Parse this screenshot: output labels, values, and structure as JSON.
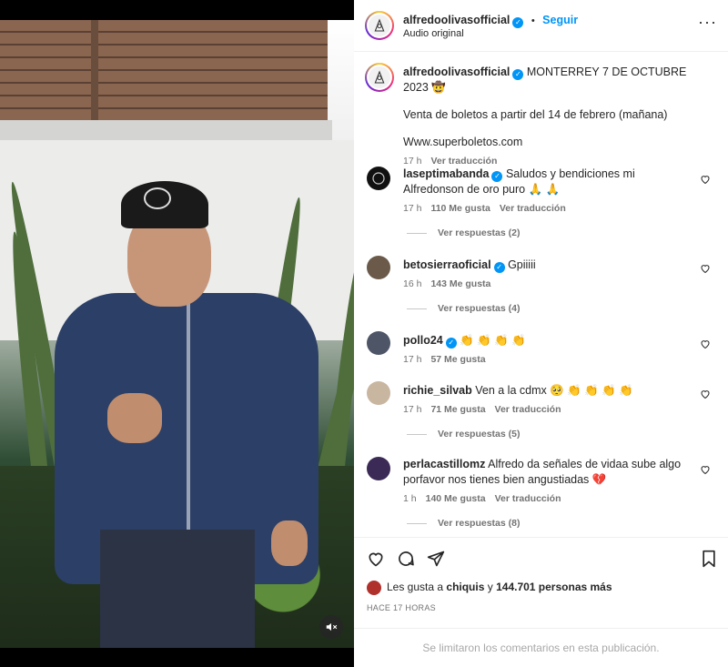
{
  "header": {
    "username": "alfredoolivasofficial",
    "separator": "•",
    "follow_label": "Seguir",
    "audio_label": "Audio original",
    "more_icon": "more-horizontal-icon"
  },
  "caption": {
    "username": "alfredoolivasofficial",
    "title": "MONTERREY 7 DE OCTUBRE 2023 🤠",
    "line1": "Venta de boletos a partir del 14 de febrero (mañana)",
    "line2": "Www.superboletos.com",
    "time": "17 h",
    "translate": "Ver traducción"
  },
  "comments": [
    {
      "username": "laseptimabanda",
      "verified": true,
      "text": "Saludos y bendiciones mi Alfredonson de oro puro 🙏 🙏",
      "time": "17 h",
      "likes": "110 Me gusta",
      "translate": "Ver traducción",
      "replies": "Ver respuestas (2)"
    },
    {
      "username": "betosierraoficial",
      "verified": true,
      "text": "Gpiiiii",
      "time": "16 h",
      "likes": "143 Me gusta",
      "translate": "",
      "replies": "Ver respuestas (4)"
    },
    {
      "username": "pollo24",
      "verified": true,
      "text": "👏 👏 👏 👏",
      "time": "17 h",
      "likes": "57 Me gusta",
      "translate": "",
      "replies": ""
    },
    {
      "username": "richie_silvab",
      "verified": false,
      "text": "Ven a la cdmx 🥺 👏 👏 👏 👏",
      "time": "17 h",
      "likes": "71 Me gusta",
      "translate": "Ver traducción",
      "replies": "Ver respuestas (5)"
    },
    {
      "username": "perlacastillomz",
      "verified": false,
      "text": "Alfredo da señales de vidaa sube algo porfavor nos tienes bien angustiadas 💔",
      "time": "1 h",
      "likes": "140 Me gusta",
      "translate": "Ver traducción",
      "replies": "Ver respuestas (8)"
    }
  ],
  "actions": {
    "likes_prefix": "Les gusta a",
    "liker": "chiquis",
    "likes_mid": "y",
    "likes_count": "144.701 personas más",
    "timestamp": "HACE 17 HORAS"
  },
  "footer": {
    "notice": "Se limitaron los comentarios en esta publicación."
  },
  "colors": {
    "accent": "#0095f6",
    "muted": "#737373"
  }
}
